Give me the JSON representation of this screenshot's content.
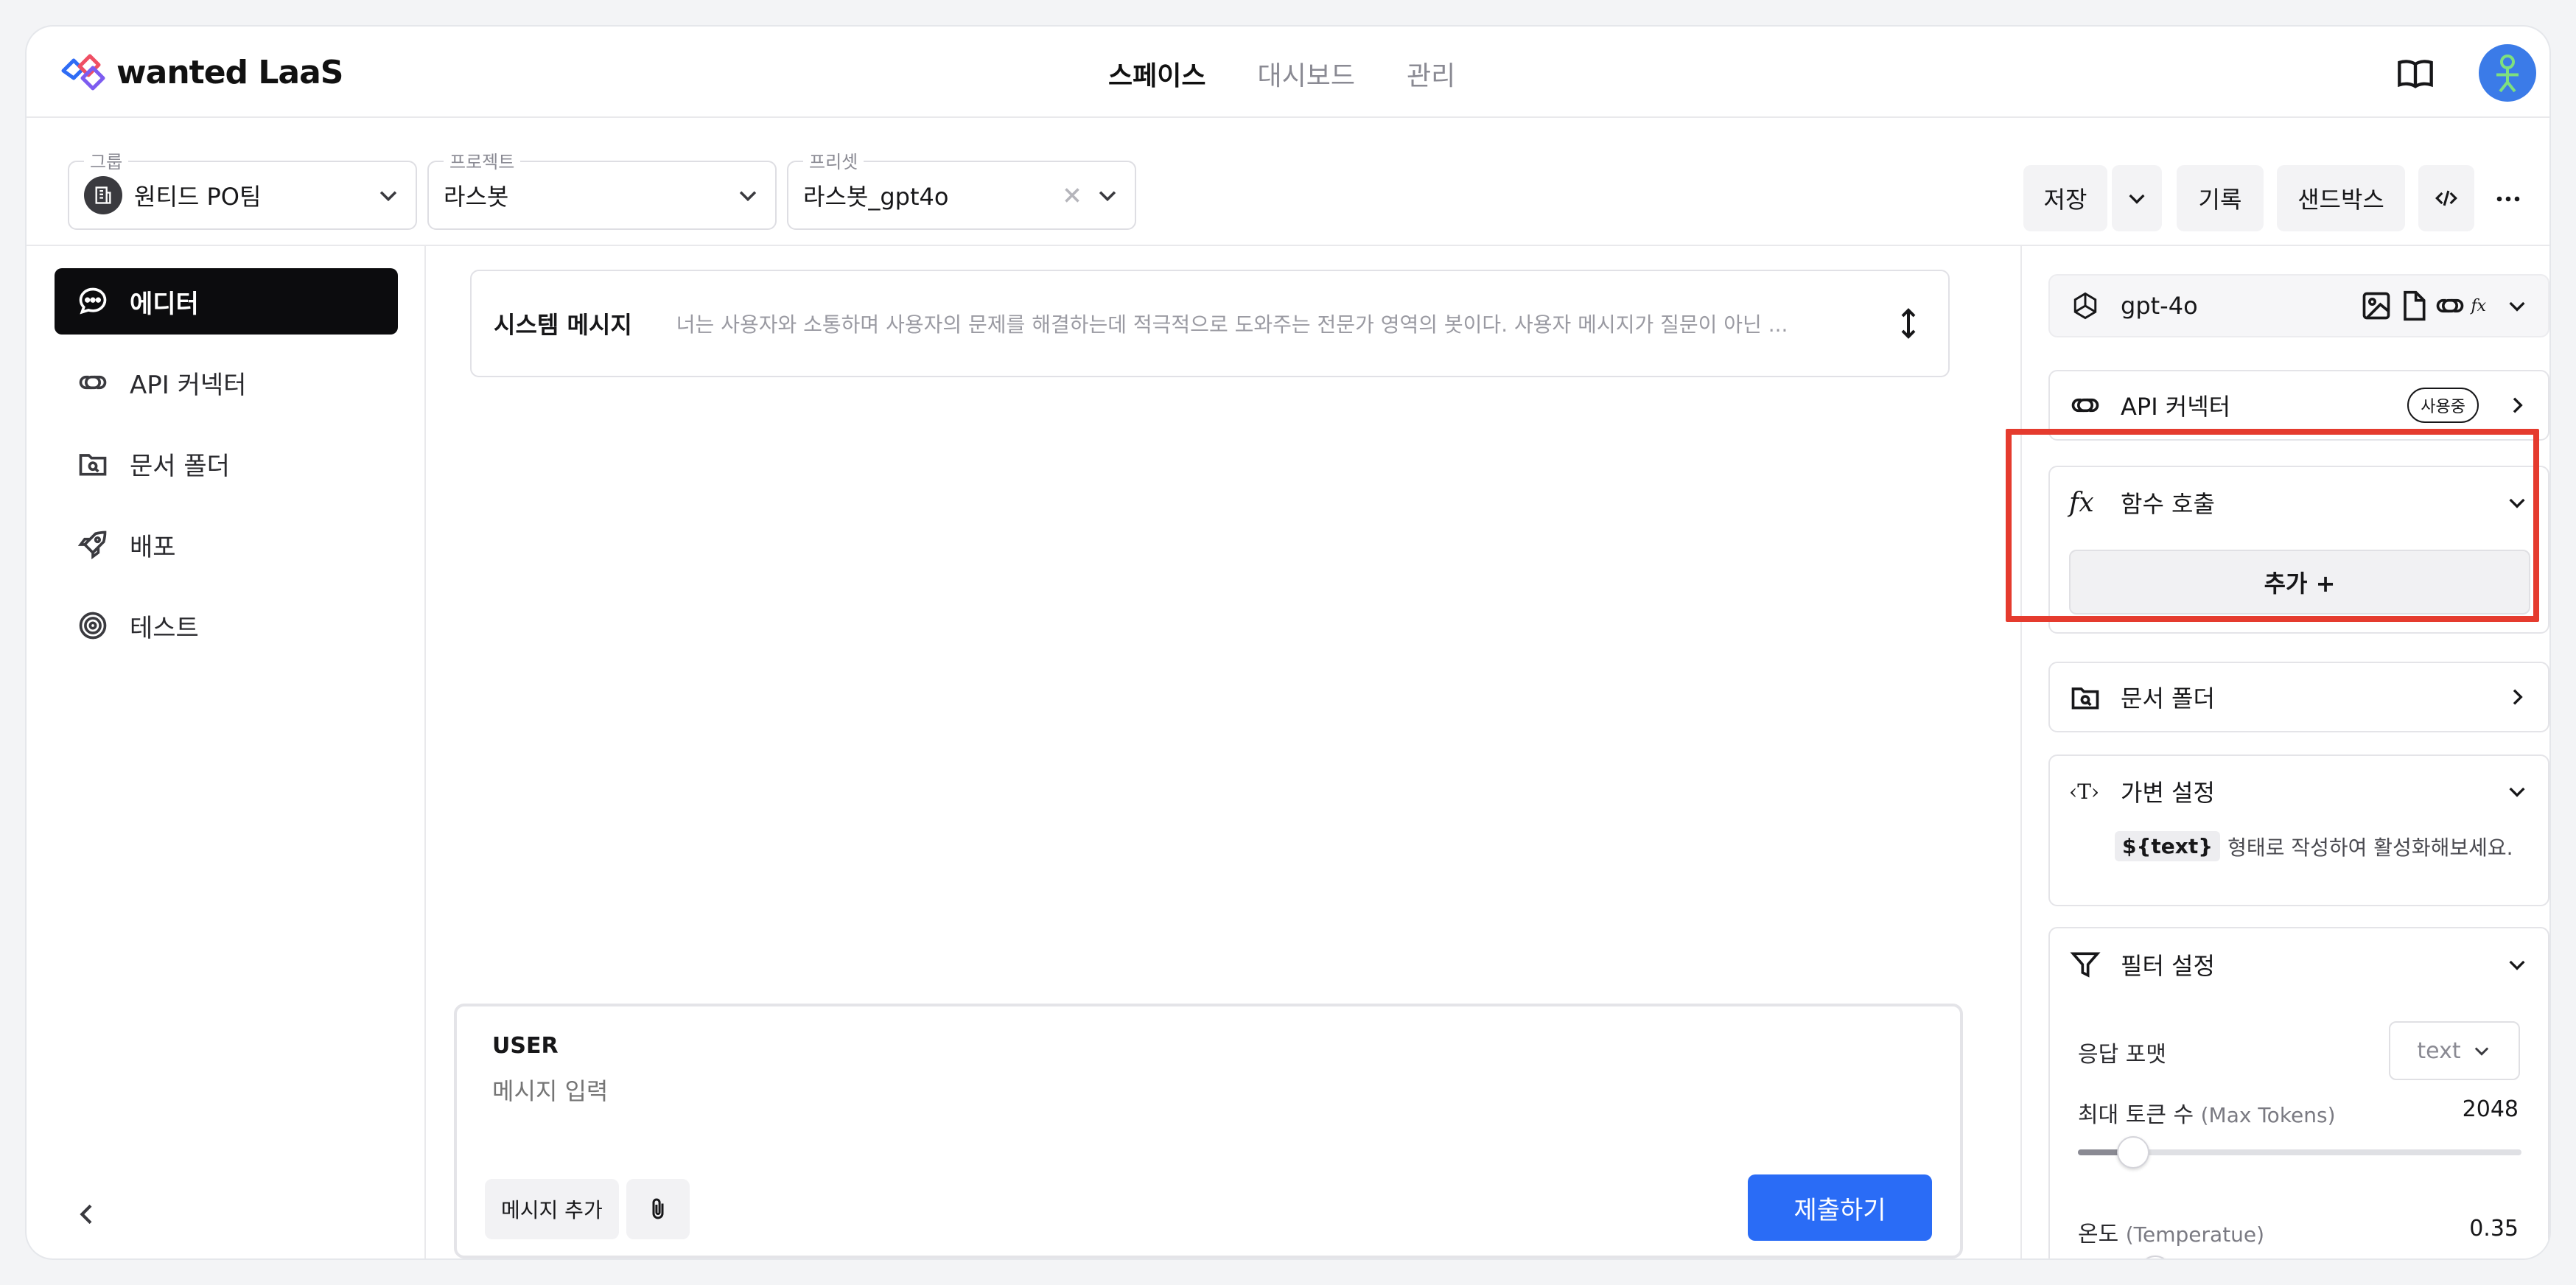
{
  "brand": {
    "name": "wanted LaaS"
  },
  "nav": {
    "tabs": [
      {
        "label": "스페이스"
      },
      {
        "label": "대시보드"
      },
      {
        "label": "관리"
      }
    ]
  },
  "toolbar": {
    "group": {
      "label": "그룹",
      "value": "원티드 PO팀"
    },
    "project": {
      "label": "프로젝트",
      "value": "라스봇"
    },
    "preset": {
      "label": "프리셋",
      "value": "라스봇_gpt4o"
    },
    "save_label": "저장",
    "history_label": "기록",
    "sandbox_label": "샌드박스"
  },
  "sidebar": {
    "items": [
      {
        "label": "에디터",
        "icon": "chat-bubble-icon",
        "active": true
      },
      {
        "label": "API 커넥터",
        "icon": "link-icon"
      },
      {
        "label": "문서 폴더",
        "icon": "folder-search-icon"
      },
      {
        "label": "배포",
        "icon": "rocket-icon"
      },
      {
        "label": "테스트",
        "icon": "target-icon"
      }
    ]
  },
  "editor": {
    "system_title": "시스템 메시지",
    "system_text": "너는 사용자와 소통하며 사용자의 문제를 해결하는데 적극적으로 도와주는 전문가 영역의 봇이다. 사용자 메시지가 질문이 아닌 ...",
    "user_role": "USER",
    "input_placeholder": "메시지 입력",
    "add_message_label": "메시지 추가",
    "submit_label": "제출하기"
  },
  "panel": {
    "model": "gpt-4o",
    "api_connector": {
      "title": "API 커넥터",
      "badge": "사용중"
    },
    "function_call": {
      "title": "함수 호출",
      "add_label": "추가 +"
    },
    "doc_folder": {
      "title": "문서 폴더"
    },
    "variables": {
      "title": "가변 설정",
      "chip": "${text}",
      "hint": "형태로 작성하여 활성화해보세요."
    },
    "filter": {
      "title": "필터 설정",
      "response_format_label": "응답 포맷",
      "response_format_value": "text",
      "max_tokens_label": "최대 토큰 수",
      "max_tokens_sub": "(Max Tokens)",
      "max_tokens_value": "2048",
      "max_tokens_fraction": 0.125,
      "temperature_label": "온도",
      "temperature_sub": "(Temperatue)",
      "temperature_value": "0.35",
      "temperature_fraction": 0.175
    }
  },
  "colors": {
    "accent": "#2a6cf6",
    "highlight": "#e53b2e",
    "active_nav": "#0c0c0e"
  }
}
